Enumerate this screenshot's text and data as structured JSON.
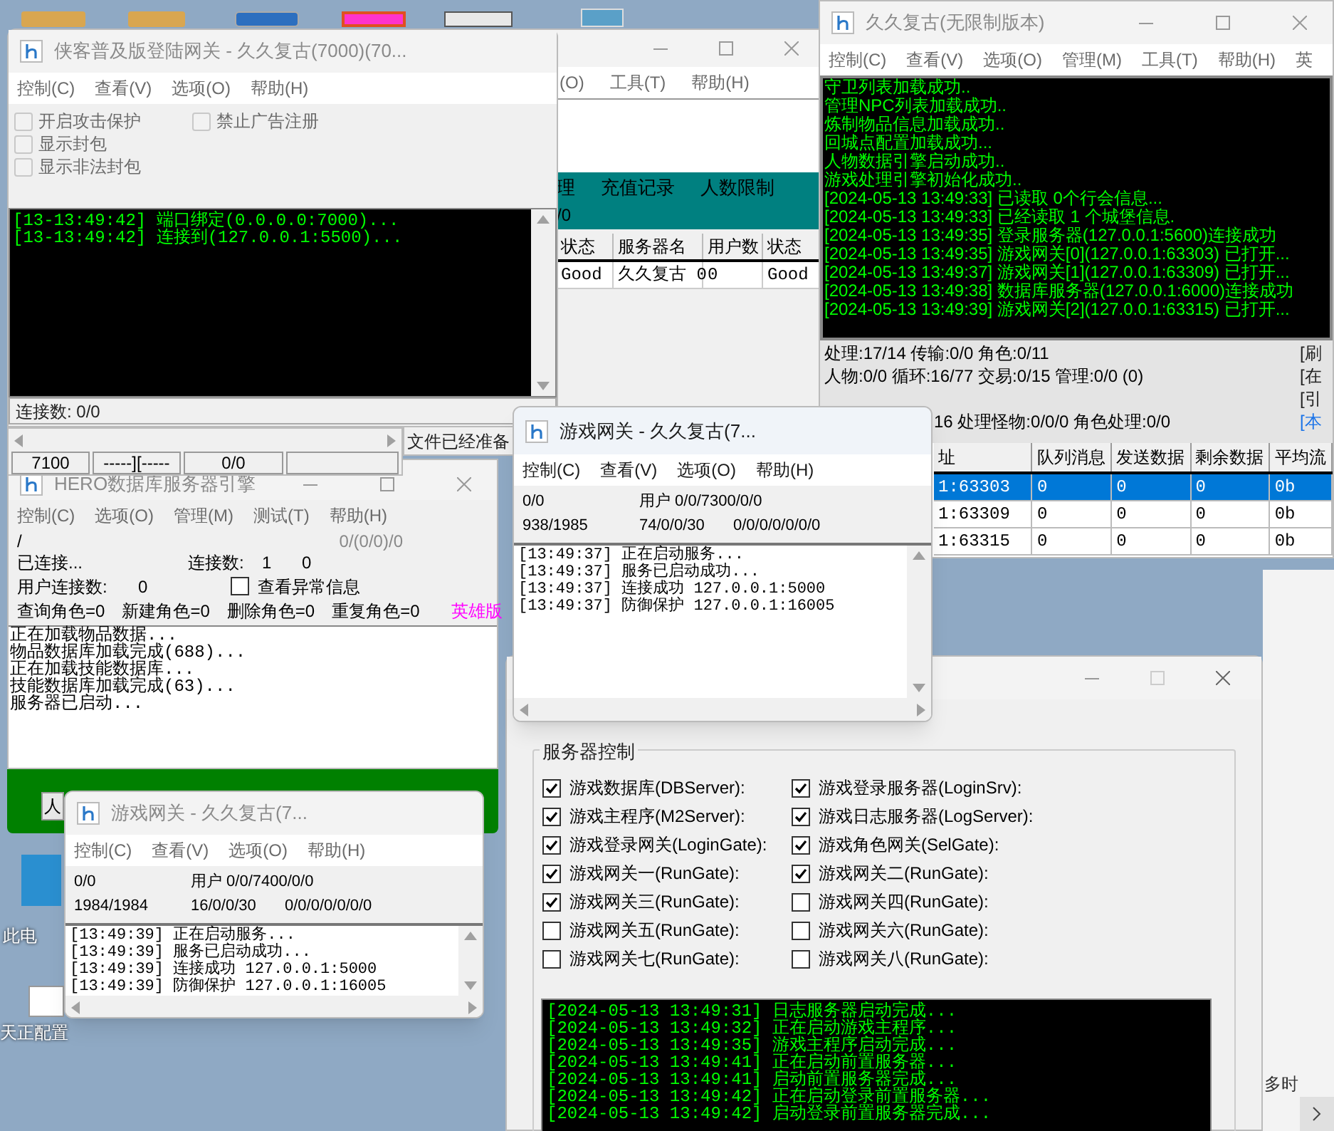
{
  "desktop": {
    "icons": [
      {
        "label": "此电"
      },
      {
        "label": "天正配置"
      }
    ],
    "edge_text": "多时"
  },
  "login_server_window": {
    "menu": [
      "(O)",
      "工具(T)",
      "帮助(H)"
    ],
    "toolbar": [
      "理",
      "充值记录",
      "人数限制"
    ],
    "toolbar_value": "/0",
    "table": {
      "columns": [
        "状态",
        "服务器名",
        "用户数",
        "状态"
      ],
      "rows": [
        [
          "Good",
          "久久复古 0",
          "0",
          "Good"
        ]
      ]
    },
    "status": "文件已经准备"
  },
  "m2_window": {
    "title": "久久复古(无限制版本)",
    "menu": [
      "控制(C)",
      "查看(V)",
      "选项(O)",
      "管理(M)",
      "工具(T)",
      "帮助(H)",
      "英"
    ],
    "log": [
      "守卫列表加载成功..",
      "管理NPC列表加载成功..",
      "炼制物品信息加载成功..",
      "回城点配置加载成功...",
      "人物数据引擎启动成功..",
      "游戏处理引擎初始化成功..",
      "[2024-05-13 13:49:33] 已读取 0个行会信息...",
      "[2024-05-13 13:49:33] 已经读取 1 个城堡信息.",
      "[2024-05-13 13:49:35] 登录服务器(127.0.0.1:5600)连接成功",
      "[2024-05-13 13:49:35] 游戏网关[0](127.0.0.1:63303) 已打开...",
      "[2024-05-13 13:49:37] 游戏网关[1](127.0.0.1:63309) 已打开...",
      "[2024-05-13 13:49:38] 数据库服务器(127.0.0.1:6000)连接成功",
      "[2024-05-13 13:49:39] 游戏网关[2](127.0.0.1:63315) 已打开..."
    ],
    "stats": [
      "处理:17/14 传输:0/0 角色:0/11",
      "人物:0/0 循环:16/77 交易:0/15 管理:0/0 (0)",
      "16 处理怪物:0/0/0 角色处理:0/0"
    ],
    "side_links": [
      {
        "text": "[刷",
        "kind": "plain"
      },
      {
        "text": "[在",
        "kind": "plain"
      },
      {
        "text": "[引",
        "kind": "plain"
      },
      {
        "text": "[本",
        "kind": "link"
      }
    ],
    "table": {
      "columns": [
        "址",
        "队列消息",
        "发送数据",
        "剩余数据",
        "平均流"
      ],
      "rows": [
        {
          "cells": [
            "1:63303",
            "0",
            "0",
            "0",
            "0b"
          ],
          "selected": true
        },
        {
          "cells": [
            "1:63309",
            "0",
            "0",
            "0",
            "0b"
          ],
          "selected": false
        },
        {
          "cells": [
            "1:63315",
            "0",
            "0",
            "0",
            "0b"
          ],
          "selected": false
        }
      ]
    }
  },
  "db_window": {
    "title": "HERO数据库服务器引擎",
    "menu": [
      "控制(C)",
      "选项(O)",
      "管理(M)",
      "测试(T)",
      "帮助(H)"
    ],
    "path": "/",
    "counter": "0/(0/0)/0",
    "connected": "已连接...",
    "connections_label": "连接数:",
    "connections": "1",
    "connections_extra": "0",
    "user_connections_label": "用户连接数:",
    "user_connections": "0",
    "show_errors": {
      "label": "查看异常信息",
      "checked": false
    },
    "role_stats": [
      "查询角色=0",
      "新建角色=0",
      "删除角色=0",
      "重复角色=0"
    ],
    "edition": "英雄版",
    "log": [
      "正在加载物品数据...",
      "物品数据库加载完成(688)...",
      "正在加载技能数据库...",
      "技能数据库加载完成(63)...",
      "服务器已启动..."
    ]
  },
  "green_panel": {
    "button": "人"
  },
  "login_gate_window": {
    "title": "侠客普及版登陆网关 - 久久复古(7000)(70...",
    "menu": [
      "控制(C)",
      "查看(V)",
      "选项(O)",
      "帮助(H)"
    ],
    "options": [
      {
        "label": "开启攻击保护",
        "checked": false
      },
      {
        "label": "禁止广告注册",
        "checked": false
      },
      {
        "label": "显示封包",
        "checked": false
      },
      {
        "label": "显示非法封包",
        "checked": false
      }
    ],
    "log": [
      "[13-13:49:42] 端口绑定(0.0.0.0:7000)...",
      "[13-13:49:42] 连接到(127.0.0.1:5500)..."
    ],
    "status": "连接数: 0/0"
  },
  "gate_status_window": {
    "cells": [
      "7100",
      "-----][-----",
      "0/0"
    ]
  },
  "control_window": {
    "group_title": "服务器控制",
    "servers": [
      {
        "label": "游戏数据库(DBServer):",
        "checked": true
      },
      {
        "label": "游戏登录服务器(LoginSrv):",
        "checked": true
      },
      {
        "label": "游戏主程序(M2Server):",
        "checked": true
      },
      {
        "label": "游戏日志服务器(LogServer):",
        "checked": true
      },
      {
        "label": "游戏登录网关(LoginGate):",
        "checked": true
      },
      {
        "label": "游戏角色网关(SelGate):",
        "checked": true
      },
      {
        "label": "游戏网关一(RunGate):",
        "checked": true
      },
      {
        "label": "游戏网关二(RunGate):",
        "checked": true
      },
      {
        "label": "游戏网关三(RunGate):",
        "checked": true
      },
      {
        "label": "游戏网关四(RunGate):",
        "checked": false
      },
      {
        "label": "游戏网关五(RunGate):",
        "checked": false
      },
      {
        "label": "游戏网关六(RunGate):",
        "checked": false
      },
      {
        "label": "游戏网关七(RunGate):",
        "checked": false
      },
      {
        "label": "游戏网关八(RunGate):",
        "checked": false
      }
    ],
    "log": [
      "[2024-05-13 13:49:31] 日志服务器启动完成...",
      "[2024-05-13 13:49:32] 正在启动游戏主程序...",
      "[2024-05-13 13:49:35] 游戏主程序启动完成...",
      "[2024-05-13 13:49:41] 正在启动前置服务器...",
      "[2024-05-13 13:49:41] 启动前置服务器完成...",
      "[2024-05-13 13:49:42] 正在启动登录前置服务器...",
      "[2024-05-13 13:49:42] 启动登录前置服务器完成..."
    ]
  },
  "run_gate_windows": [
    {
      "title": "游戏网关 - 久久复古(7...",
      "active": true,
      "menu": [
        "控制(C)",
        "查看(V)",
        "选项(O)",
        "帮助(H)"
      ],
      "stats_row_1": [
        "0/0",
        "用户 0/0/7300/0/0"
      ],
      "stats_row_2": [
        "938/1985",
        "74/0/0/30",
        "0/0/0/0/0/0/0"
      ],
      "log": [
        "[13:49:37] 正在启动服务...",
        "[13:49:37] 服务已启动成功...",
        "[13:49:37] 连接成功 127.0.0.1:5000",
        "[13:49:37] 防御保护 127.0.0.1:16005"
      ]
    },
    {
      "title": "游戏网关 - 久久复古(7...",
      "active": false,
      "menu": [
        "控制(C)",
        "查看(V)",
        "选项(O)",
        "帮助(H)"
      ],
      "stats_row_1": [
        "0/0",
        "用户 0/0/7400/0/0"
      ],
      "stats_row_2": [
        "1984/1984",
        "16/0/0/30",
        "0/0/0/0/0/0/0"
      ],
      "log": [
        "[13:49:39] 正在启动服务...",
        "[13:49:39] 服务已启动成功...",
        "[13:49:39] 连接成功 127.0.0.1:5000",
        "[13:49:39] 防御保护 127.0.0.1:16005"
      ]
    }
  ]
}
